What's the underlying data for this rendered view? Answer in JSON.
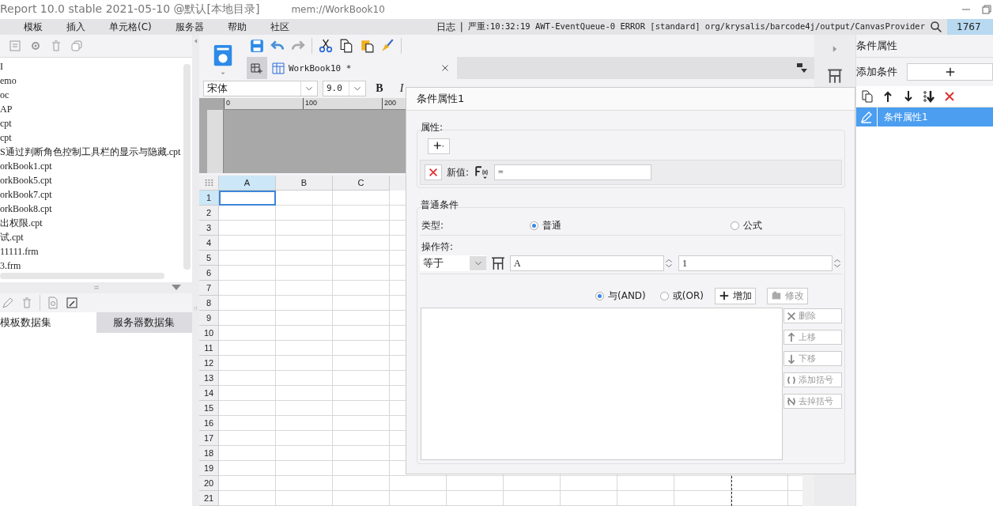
{
  "title_bar": {
    "app": "Report 10.0 stable 2021-05-10 @默认[本地目录]",
    "file": "mem://WorkBook10"
  },
  "menu": [
    {
      "label": "模板"
    },
    {
      "label": "插入"
    },
    {
      "label": "单元格(C)"
    },
    {
      "label": "服务器"
    },
    {
      "label": "帮助"
    },
    {
      "label": "社区"
    }
  ],
  "log": {
    "label": "日志",
    "separator": "|",
    "message": "严重:10:32:19 AWT-EventQueue-0 ERROR [standard] org/krysalis/barcode4j/output/CanvasProvider",
    "count": "1767"
  },
  "left_panel": {
    "files": [
      "I",
      "emo",
      "oc",
      "AP",
      "cpt",
      "cpt",
      "S通过判断角色控制工具栏的显示与隐藏.cpt",
      "orkBook1.cpt",
      "orkBook5.cpt",
      "orkBook7.cpt",
      "orkBook8.cpt",
      "出权限.cpt",
      "试.cpt",
      "11111.frm",
      "3.frm"
    ],
    "dataset_tabs": [
      {
        "label": "模板数据集",
        "selected": true
      },
      {
        "label": "服务器数据集",
        "selected": false
      }
    ]
  },
  "editor": {
    "tab": "WorkBook10 *",
    "font": "宋体",
    "font_size": "9.0",
    "format_buttons": [
      "B",
      "I"
    ],
    "ruler_marks": [
      "0",
      "100",
      "200"
    ],
    "columns": [
      {
        "label": "A",
        "selected": true
      },
      {
        "label": "B",
        "selected": false
      },
      {
        "label": "C",
        "selected": false
      }
    ],
    "rows": [
      {
        "label": "1",
        "selected": true
      },
      {
        "label": "2",
        "selected": false
      },
      {
        "label": "3",
        "selected": false
      },
      {
        "label": "4",
        "selected": false
      },
      {
        "label": "5",
        "selected": false
      },
      {
        "label": "6",
        "selected": false
      },
      {
        "label": "7",
        "selected": false
      },
      {
        "label": "8",
        "selected": false
      },
      {
        "label": "9",
        "selected": false
      },
      {
        "label": "10",
        "selected": false
      },
      {
        "label": "11",
        "selected": false
      },
      {
        "label": "12",
        "selected": false
      },
      {
        "label": "13",
        "selected": false
      },
      {
        "label": "14",
        "selected": false
      },
      {
        "label": "15",
        "selected": false
      },
      {
        "label": "16",
        "selected": false
      },
      {
        "label": "17",
        "selected": false
      },
      {
        "label": "18",
        "selected": false
      },
      {
        "label": "19",
        "selected": false
      },
      {
        "label": "20",
        "selected": false
      },
      {
        "label": "21",
        "selected": false
      }
    ]
  },
  "right_panel": {
    "title": "条件属性",
    "add_label": "添加条件",
    "conditions": [
      {
        "label": "条件属性1",
        "selected": true
      }
    ]
  },
  "dialog": {
    "title": "条件属性1",
    "property_section": {
      "legend": "属性:",
      "value_label": "新值:",
      "value": "="
    },
    "condition_section": {
      "legend": "普通条件",
      "type_label": "类型:",
      "types": [
        {
          "label": "普通",
          "selected": true
        },
        {
          "label": "公式",
          "selected": false
        }
      ],
      "operator_label": "操作符:",
      "operator": "等于",
      "operand_1": "A",
      "operand_2": "1",
      "joins": [
        {
          "label": "与(AND)",
          "selected": true
        },
        {
          "label": "或(OR)",
          "selected": false
        }
      ],
      "actions": [
        {
          "label": "增加",
          "kind": "add",
          "disabled": false
        },
        {
          "label": "修改",
          "kind": "edit",
          "disabled": true
        }
      ],
      "list_actions": [
        {
          "label": "删除",
          "kind": "delete",
          "disabled": true
        },
        {
          "label": "上移",
          "kind": "up",
          "disabled": true
        },
        {
          "label": "下移",
          "kind": "down",
          "disabled": true
        },
        {
          "label": "添加括号",
          "kind": "add-brackets",
          "disabled": true
        },
        {
          "label": "去掉括号",
          "kind": "remove-brackets",
          "disabled": true
        }
      ]
    }
  }
}
